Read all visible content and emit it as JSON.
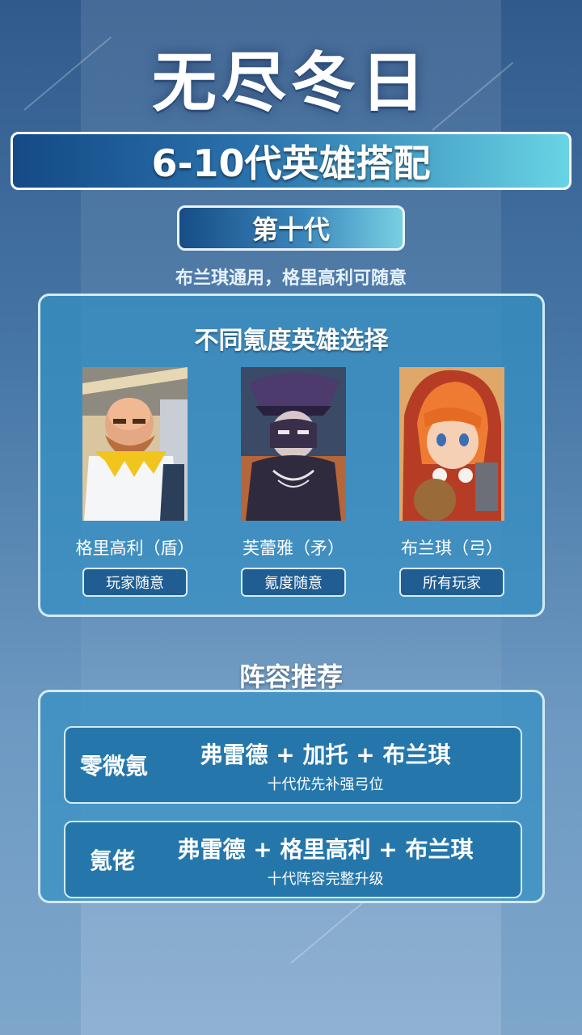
{
  "header": {
    "title": "无尽冬日",
    "subtitle": "6-10代英雄搭配"
  },
  "generation": {
    "label": "第十代",
    "note": "布兰琪通用，格里高利可随意"
  },
  "hero_section": {
    "heading": "不同氪度英雄选择",
    "heroes": [
      {
        "name": "格里高利（盾）",
        "tag": "玩家随意",
        "portrait": "gregory-portrait"
      },
      {
        "name": "芙蕾雅（矛）",
        "tag": "氪度随意",
        "portrait": "freya-portrait"
      },
      {
        "name": "布兰琪（弓）",
        "tag": "所有玩家",
        "portrait": "blanchette-portrait"
      }
    ]
  },
  "lineups": {
    "title": "阵容推荐",
    "items": [
      {
        "label": "零微氪",
        "combo": "弗雷德 + 加托 + 布兰琪",
        "note": "十代优先补强弓位"
      },
      {
        "label": "氪佬",
        "combo": "弗雷德 + 格里高利 + 布兰琪",
        "note": "十代阵容完整升级"
      }
    ]
  },
  "colors": {
    "background_top": "#315a8c",
    "background_bottom": "#7ea6cb",
    "panel": "#3490c4",
    "banner_start": "#144a86",
    "banner_end": "#68d4e4",
    "tag": "#1f5d93"
  }
}
